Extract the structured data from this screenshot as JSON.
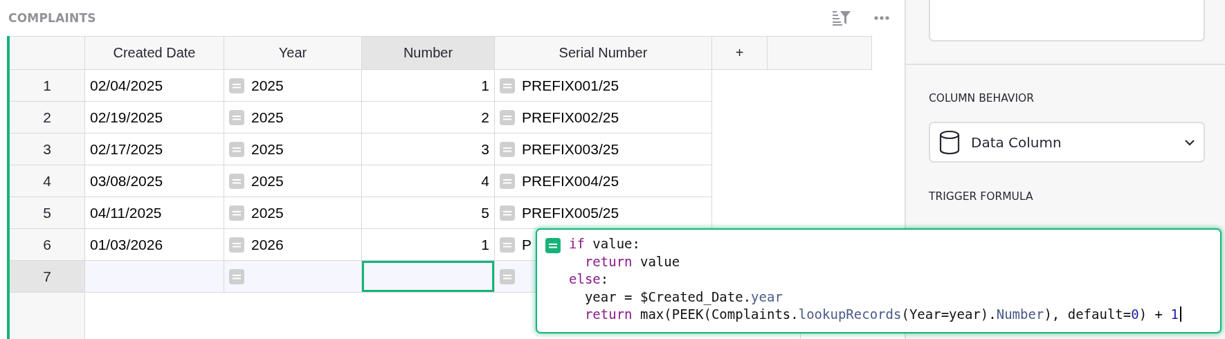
{
  "section": {
    "title": "COMPLAINTS"
  },
  "grid": {
    "columns": [
      {
        "label": "Created Date",
        "kind": "date",
        "selected": false
      },
      {
        "label": "Year",
        "kind": "formula",
        "selected": false
      },
      {
        "label": "Number",
        "kind": "number",
        "selected": true
      },
      {
        "label": "Serial Number",
        "kind": "formula",
        "selected": false
      }
    ],
    "add_column": "+",
    "rows": [
      {
        "number": "1",
        "kind": "record",
        "selected": false,
        "cells": [
          "02/04/2025",
          "2025",
          "1",
          "PREFIX001/25"
        ]
      },
      {
        "number": "2",
        "kind": "record",
        "selected": false,
        "cells": [
          "02/19/2025",
          "2025",
          "2",
          "PREFIX002/25"
        ]
      },
      {
        "number": "3",
        "kind": "record",
        "selected": false,
        "cells": [
          "02/17/2025",
          "2025",
          "3",
          "PREFIX003/25"
        ]
      },
      {
        "number": "4",
        "kind": "record",
        "selected": false,
        "cells": [
          "03/08/2025",
          "2025",
          "4",
          "PREFIX004/25"
        ]
      },
      {
        "number": "5",
        "kind": "record",
        "selected": false,
        "cells": [
          "04/11/2025",
          "2025",
          "5",
          "PREFIX005/25"
        ]
      },
      {
        "number": "6",
        "kind": "record",
        "selected": false,
        "cells": [
          "01/03/2026",
          "2026",
          "1",
          "P"
        ]
      },
      {
        "number": "7",
        "kind": "new",
        "selected": true
      }
    ]
  },
  "panel": {
    "column_behavior": {
      "heading": "COLUMN BEHAVIOR",
      "value": "Data Column"
    },
    "trigger_formula": {
      "heading": "TRIGGER FORMULA"
    }
  },
  "editor": {
    "lines": [
      {
        "tokens": [
          {
            "text": "if",
            "kind": "keyword"
          },
          {
            "text": " value:",
            "kind": "plain"
          }
        ]
      },
      {
        "tokens": [
          {
            "text": "  return",
            "kind": "keyword"
          },
          {
            "text": " value",
            "kind": "plain"
          }
        ]
      },
      {
        "tokens": [
          {
            "text": "else",
            "kind": "keyword"
          },
          {
            "text": ":",
            "kind": "plain"
          }
        ]
      },
      {
        "tokens": [
          {
            "text": "  year = $Created_Date.",
            "kind": "plain"
          },
          {
            "text": "year",
            "kind": "attr"
          }
        ]
      },
      {
        "tokens": [
          {
            "text": "  return",
            "kind": "keyword"
          },
          {
            "text": " max(PEEK(Complaints.",
            "kind": "plain"
          },
          {
            "text": "lookupRecords",
            "kind": "attr"
          },
          {
            "text": "(Year=year).",
            "kind": "plain"
          },
          {
            "text": "Number",
            "kind": "attr"
          },
          {
            "text": "), default=",
            "kind": "plain"
          },
          {
            "text": "0",
            "kind": "number"
          },
          {
            "text": ") + ",
            "kind": "plain"
          },
          {
            "text": "1",
            "kind": "number"
          }
        ]
      }
    ]
  }
}
